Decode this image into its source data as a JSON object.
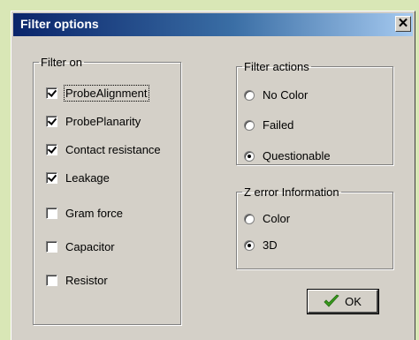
{
  "window": {
    "title": "Filter options",
    "close_glyph": "✕"
  },
  "filter_on": {
    "legend": "Filter on",
    "items": [
      {
        "label": "ProbeAlignment",
        "checked": true,
        "focused": true
      },
      {
        "label": "ProbePlanarity",
        "checked": true
      },
      {
        "label": "Contact resistance",
        "checked": true
      },
      {
        "label": "Leakage",
        "checked": true
      },
      {
        "label": "Gram force",
        "checked": false
      },
      {
        "label": "Capacitor",
        "checked": false
      },
      {
        "label": "Resistor",
        "checked": false
      }
    ]
  },
  "filter_actions": {
    "legend": "Filter actions",
    "options": [
      {
        "label": "No Color",
        "selected": false
      },
      {
        "label": "Failed",
        "selected": false
      },
      {
        "label": "Questionable",
        "selected": true
      }
    ]
  },
  "z_error": {
    "legend": "Z error Information",
    "options": [
      {
        "label": "Color",
        "selected": false
      },
      {
        "label": "3D",
        "selected": true
      }
    ]
  },
  "ok_button": {
    "label": "OK",
    "icon": "green-checkmark-icon",
    "icon_color": "#3a9a1e"
  },
  "colors": {
    "title_bar": "#0a246a",
    "dialog_face": "#d4d0c8",
    "background": "#d9e7b6"
  }
}
